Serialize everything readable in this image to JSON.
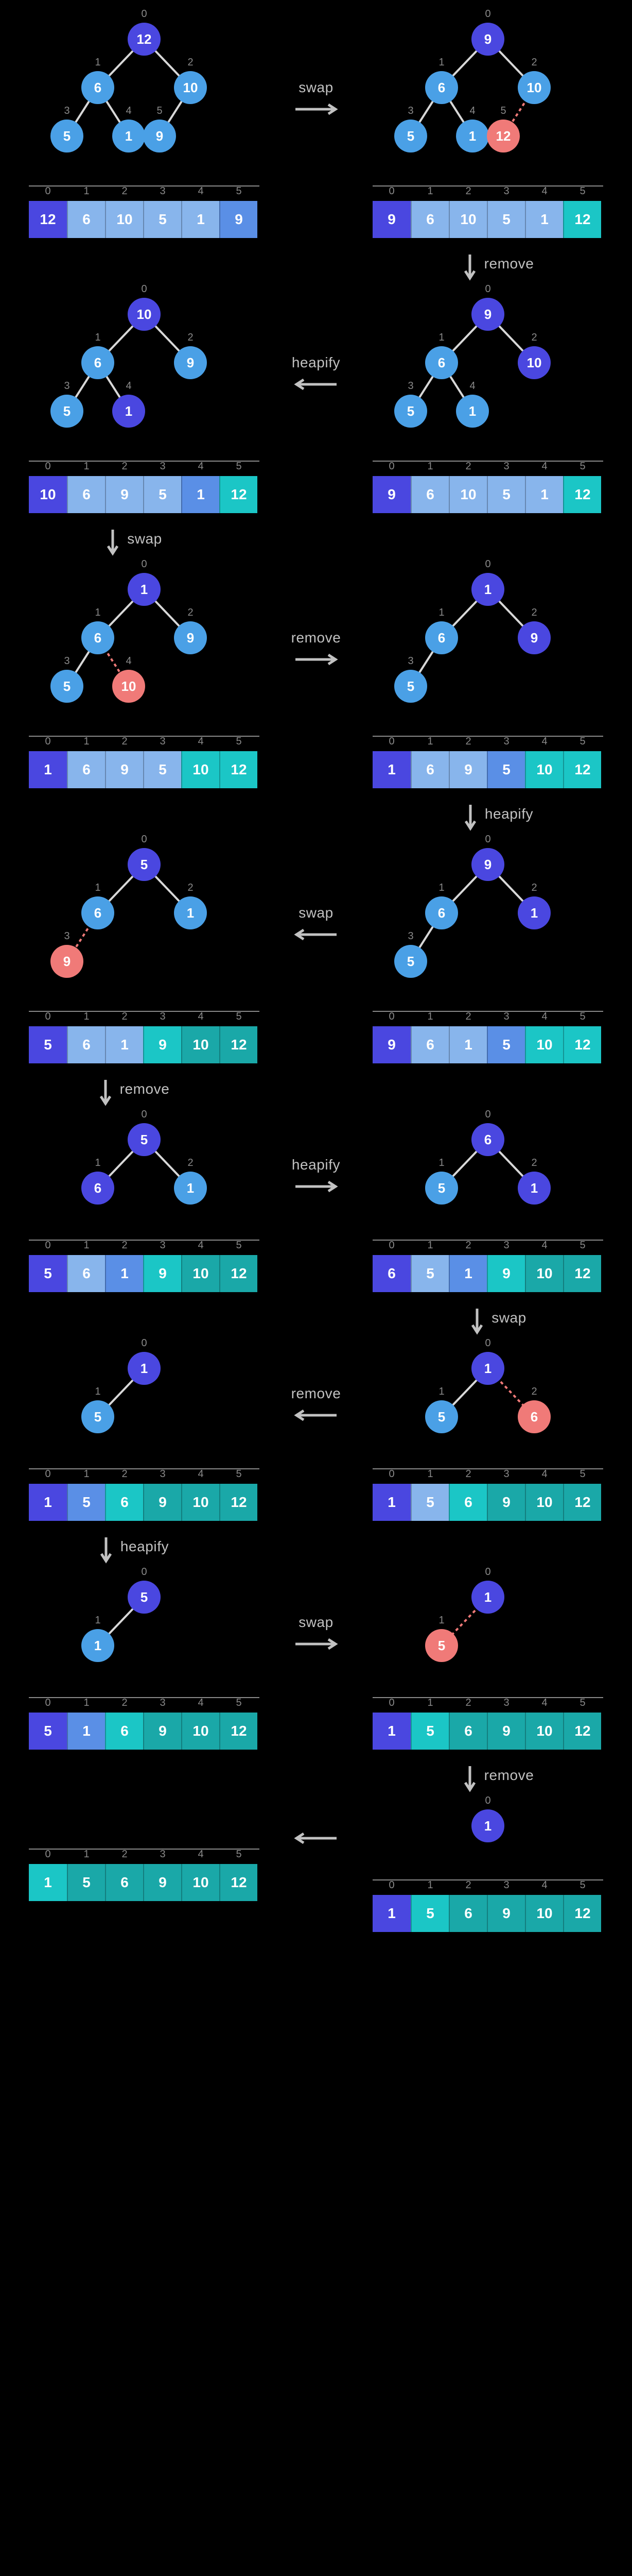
{
  "colors": {
    "purple": "#4a47e0",
    "blue": "#4aa0e6",
    "teal": "#1bc6c6",
    "coral": "#f07a78"
  },
  "labels": {
    "swap": "swap",
    "remove": "remove",
    "heapify": "heapify"
  },
  "indices": [
    "0",
    "1",
    "2",
    "3",
    "4",
    "5"
  ],
  "steps": [
    {
      "op": "swap",
      "dir": "right",
      "left_tree": [
        {
          "i": 0,
          "v": "12",
          "c": "purple"
        },
        {
          "i": 1,
          "v": "6",
          "c": "blue"
        },
        {
          "i": 2,
          "v": "10",
          "c": "blue"
        },
        {
          "i": 3,
          "v": "5",
          "c": "blue"
        },
        {
          "i": 4,
          "v": "1",
          "c": "blue"
        },
        {
          "i": 5,
          "v": "9",
          "c": "blue"
        }
      ],
      "right_tree": [
        {
          "i": 0,
          "v": "9",
          "c": "purple"
        },
        {
          "i": 1,
          "v": "6",
          "c": "blue"
        },
        {
          "i": 2,
          "v": "10",
          "c": "blue"
        },
        {
          "i": 3,
          "v": "5",
          "c": "blue"
        },
        {
          "i": 4,
          "v": "1",
          "c": "blue"
        },
        {
          "i": 5,
          "v": "12",
          "c": "coral",
          "cut": true
        }
      ],
      "left_arr": [
        {
          "v": "12",
          "c": "purple"
        },
        {
          "v": "6",
          "c": "light"
        },
        {
          "v": "10",
          "c": "light"
        },
        {
          "v": "5",
          "c": "light"
        },
        {
          "v": "1",
          "c": "light"
        },
        {
          "v": "9",
          "c": "mid"
        }
      ],
      "right_arr": [
        {
          "v": "9",
          "c": "purple"
        },
        {
          "v": "6",
          "c": "light"
        },
        {
          "v": "10",
          "c": "light"
        },
        {
          "v": "5",
          "c": "light"
        },
        {
          "v": "1",
          "c": "light"
        },
        {
          "v": "12",
          "c": "teal"
        }
      ],
      "after": {
        "op": "remove",
        "dir": "down",
        "side": "right"
      }
    },
    {
      "op": "heapify",
      "dir": "left",
      "left_tree": [
        {
          "i": 0,
          "v": "10",
          "c": "purple"
        },
        {
          "i": 1,
          "v": "6",
          "c": "blue"
        },
        {
          "i": 2,
          "v": "9",
          "c": "blue"
        },
        {
          "i": 3,
          "v": "5",
          "c": "blue"
        },
        {
          "i": 4,
          "v": "1",
          "c": "purple"
        }
      ],
      "right_tree": [
        {
          "i": 0,
          "v": "9",
          "c": "purple"
        },
        {
          "i": 1,
          "v": "6",
          "c": "blue"
        },
        {
          "i": 2,
          "v": "10",
          "c": "purple"
        },
        {
          "i": 3,
          "v": "5",
          "c": "blue"
        },
        {
          "i": 4,
          "v": "1",
          "c": "blue"
        }
      ],
      "left_arr": [
        {
          "v": "10",
          "c": "purple"
        },
        {
          "v": "6",
          "c": "light"
        },
        {
          "v": "9",
          "c": "light"
        },
        {
          "v": "5",
          "c": "light"
        },
        {
          "v": "1",
          "c": "mid"
        },
        {
          "v": "12",
          "c": "teal"
        }
      ],
      "right_arr": [
        {
          "v": "9",
          "c": "purple"
        },
        {
          "v": "6",
          "c": "light"
        },
        {
          "v": "10",
          "c": "light"
        },
        {
          "v": "5",
          "c": "light"
        },
        {
          "v": "1",
          "c": "light"
        },
        {
          "v": "12",
          "c": "teal"
        }
      ],
      "after": {
        "op": "swap",
        "dir": "down",
        "side": "left"
      }
    },
    {
      "op": "remove",
      "dir": "right",
      "left_tree": [
        {
          "i": 0,
          "v": "1",
          "c": "purple"
        },
        {
          "i": 1,
          "v": "6",
          "c": "blue"
        },
        {
          "i": 2,
          "v": "9",
          "c": "blue"
        },
        {
          "i": 3,
          "v": "5",
          "c": "blue"
        },
        {
          "i": 4,
          "v": "10",
          "c": "coral",
          "cut": true
        }
      ],
      "right_tree": [
        {
          "i": 0,
          "v": "1",
          "c": "purple"
        },
        {
          "i": 1,
          "v": "6",
          "c": "blue"
        },
        {
          "i": 2,
          "v": "9",
          "c": "purple"
        },
        {
          "i": 3,
          "v": "5",
          "c": "blue"
        }
      ],
      "left_arr": [
        {
          "v": "1",
          "c": "purple"
        },
        {
          "v": "6",
          "c": "light"
        },
        {
          "v": "9",
          "c": "light"
        },
        {
          "v": "5",
          "c": "light"
        },
        {
          "v": "10",
          "c": "teal"
        },
        {
          "v": "12",
          "c": "teal"
        }
      ],
      "right_arr": [
        {
          "v": "1",
          "c": "purple"
        },
        {
          "v": "6",
          "c": "light"
        },
        {
          "v": "9",
          "c": "light"
        },
        {
          "v": "5",
          "c": "mid"
        },
        {
          "v": "10",
          "c": "teal"
        },
        {
          "v": "12",
          "c": "teal"
        }
      ],
      "after": {
        "op": "heapify",
        "dir": "down",
        "side": "right"
      }
    },
    {
      "op": "swap",
      "dir": "left",
      "left_tree": [
        {
          "i": 0,
          "v": "5",
          "c": "purple"
        },
        {
          "i": 1,
          "v": "6",
          "c": "blue"
        },
        {
          "i": 2,
          "v": "1",
          "c": "blue"
        },
        {
          "i": 3,
          "v": "9",
          "c": "coral",
          "cut": true
        }
      ],
      "right_tree": [
        {
          "i": 0,
          "v": "9",
          "c": "purple"
        },
        {
          "i": 1,
          "v": "6",
          "c": "blue"
        },
        {
          "i": 2,
          "v": "1",
          "c": "purple"
        },
        {
          "i": 3,
          "v": "5",
          "c": "blue"
        }
      ],
      "left_arr": [
        {
          "v": "5",
          "c": "purple"
        },
        {
          "v": "6",
          "c": "light"
        },
        {
          "v": "1",
          "c": "light"
        },
        {
          "v": "9",
          "c": "teal"
        },
        {
          "v": "10",
          "c": "tealD"
        },
        {
          "v": "12",
          "c": "tealD"
        }
      ],
      "right_arr": [
        {
          "v": "9",
          "c": "purple"
        },
        {
          "v": "6",
          "c": "light"
        },
        {
          "v": "1",
          "c": "light"
        },
        {
          "v": "5",
          "c": "mid"
        },
        {
          "v": "10",
          "c": "teal"
        },
        {
          "v": "12",
          "c": "teal"
        }
      ],
      "after": {
        "op": "remove",
        "dir": "down",
        "side": "left"
      }
    },
    {
      "op": "heapify",
      "dir": "right",
      "left_tree": [
        {
          "i": 0,
          "v": "5",
          "c": "purple"
        },
        {
          "i": 1,
          "v": "6",
          "c": "purple"
        },
        {
          "i": 2,
          "v": "1",
          "c": "blue"
        }
      ],
      "right_tree": [
        {
          "i": 0,
          "v": "6",
          "c": "purple"
        },
        {
          "i": 1,
          "v": "5",
          "c": "blue"
        },
        {
          "i": 2,
          "v": "1",
          "c": "purple"
        }
      ],
      "left_arr": [
        {
          "v": "5",
          "c": "purple"
        },
        {
          "v": "6",
          "c": "light"
        },
        {
          "v": "1",
          "c": "mid"
        },
        {
          "v": "9",
          "c": "teal"
        },
        {
          "v": "10",
          "c": "tealD"
        },
        {
          "v": "12",
          "c": "tealD"
        }
      ],
      "right_arr": [
        {
          "v": "6",
          "c": "purple"
        },
        {
          "v": "5",
          "c": "light"
        },
        {
          "v": "1",
          "c": "mid"
        },
        {
          "v": "9",
          "c": "teal"
        },
        {
          "v": "10",
          "c": "tealD"
        },
        {
          "v": "12",
          "c": "tealD"
        }
      ],
      "after": {
        "op": "swap",
        "dir": "down",
        "side": "right"
      }
    },
    {
      "op": "remove",
      "dir": "left",
      "left_tree": [
        {
          "i": 0,
          "v": "1",
          "c": "purple"
        },
        {
          "i": 1,
          "v": "5",
          "c": "blue"
        }
      ],
      "right_tree": [
        {
          "i": 0,
          "v": "1",
          "c": "purple"
        },
        {
          "i": 1,
          "v": "5",
          "c": "blue"
        },
        {
          "i": 2,
          "v": "6",
          "c": "coral",
          "cut": true
        }
      ],
      "left_arr": [
        {
          "v": "1",
          "c": "purple"
        },
        {
          "v": "5",
          "c": "mid"
        },
        {
          "v": "6",
          "c": "teal"
        },
        {
          "v": "9",
          "c": "tealD"
        },
        {
          "v": "10",
          "c": "tealD"
        },
        {
          "v": "12",
          "c": "tealD"
        }
      ],
      "right_arr": [
        {
          "v": "1",
          "c": "purple"
        },
        {
          "v": "5",
          "c": "light"
        },
        {
          "v": "6",
          "c": "teal"
        },
        {
          "v": "9",
          "c": "tealD"
        },
        {
          "v": "10",
          "c": "tealD"
        },
        {
          "v": "12",
          "c": "tealD"
        }
      ],
      "after": {
        "op": "heapify",
        "dir": "down",
        "side": "left"
      }
    },
    {
      "op": "swap",
      "dir": "right",
      "left_tree": [
        {
          "i": 0,
          "v": "5",
          "c": "purple"
        },
        {
          "i": 1,
          "v": "1",
          "c": "blue"
        }
      ],
      "right_tree": [
        {
          "i": 0,
          "v": "1",
          "c": "purple"
        },
        {
          "i": 1,
          "v": "5",
          "c": "coral",
          "cut": true
        }
      ],
      "left_arr": [
        {
          "v": "5",
          "c": "purple"
        },
        {
          "v": "1",
          "c": "mid"
        },
        {
          "v": "6",
          "c": "teal"
        },
        {
          "v": "9",
          "c": "tealD"
        },
        {
          "v": "10",
          "c": "tealD"
        },
        {
          "v": "12",
          "c": "tealD"
        }
      ],
      "right_arr": [
        {
          "v": "1",
          "c": "purple"
        },
        {
          "v": "5",
          "c": "teal"
        },
        {
          "v": "6",
          "c": "tealD"
        },
        {
          "v": "9",
          "c": "tealD"
        },
        {
          "v": "10",
          "c": "tealD"
        },
        {
          "v": "12",
          "c": "tealD"
        }
      ],
      "after": {
        "op": "remove",
        "dir": "down",
        "side": "right"
      }
    },
    {
      "op": "",
      "dir": "left",
      "left_tree": [],
      "right_tree": [
        {
          "i": 0,
          "v": "1",
          "c": "purple"
        }
      ],
      "left_arr": [
        {
          "v": "1",
          "c": "teal"
        },
        {
          "v": "5",
          "c": "tealD"
        },
        {
          "v": "6",
          "c": "tealD"
        },
        {
          "v": "9",
          "c": "tealD"
        },
        {
          "v": "10",
          "c": "tealD"
        },
        {
          "v": "12",
          "c": "tealD"
        }
      ],
      "right_arr": [
        {
          "v": "1",
          "c": "purple"
        },
        {
          "v": "5",
          "c": "teal"
        },
        {
          "v": "6",
          "c": "tealD"
        },
        {
          "v": "9",
          "c": "tealD"
        },
        {
          "v": "10",
          "c": "tealD"
        },
        {
          "v": "12",
          "c": "tealD"
        }
      ],
      "after": null
    }
  ]
}
